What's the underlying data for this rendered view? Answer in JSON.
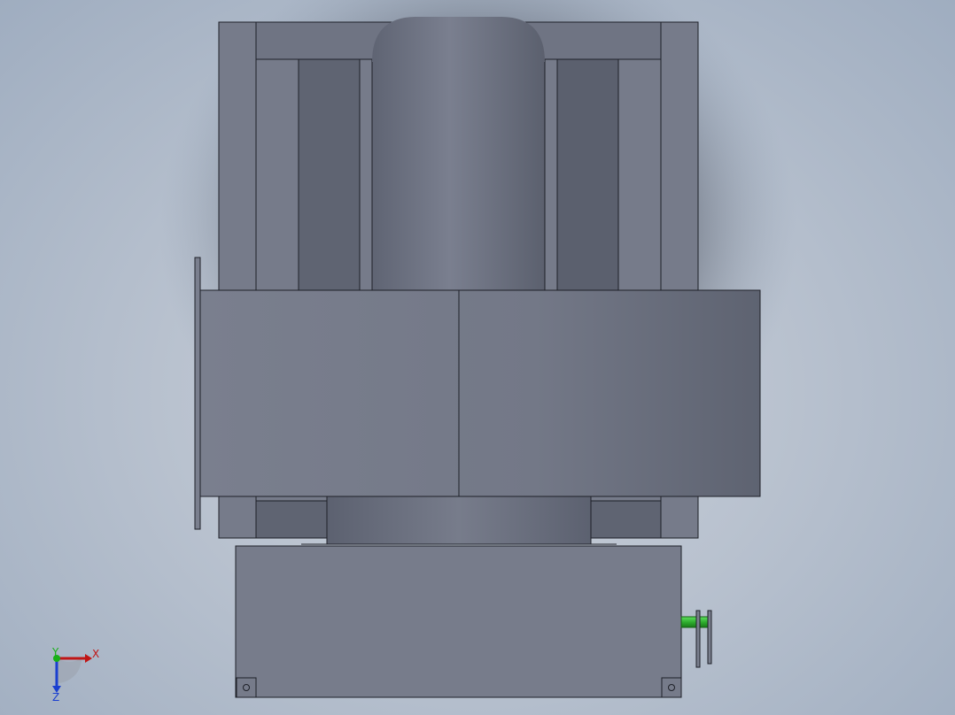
{
  "app": {
    "title": "",
    "view": "front-view-3d-model",
    "background_colors": [
      "#c9cfd9",
      "#9fadc0"
    ]
  },
  "model": {
    "body_color": "#767b8a",
    "dark_panel_color": "#5d6270",
    "outline_color": "#1e2028",
    "shaft_color": "#2fae2f"
  },
  "triad": {
    "x_label": "X",
    "y_label": "Y",
    "z_label": "Z",
    "x_color": "#c01515",
    "y_color": "#18b018",
    "z_color": "#1a3fd0"
  }
}
